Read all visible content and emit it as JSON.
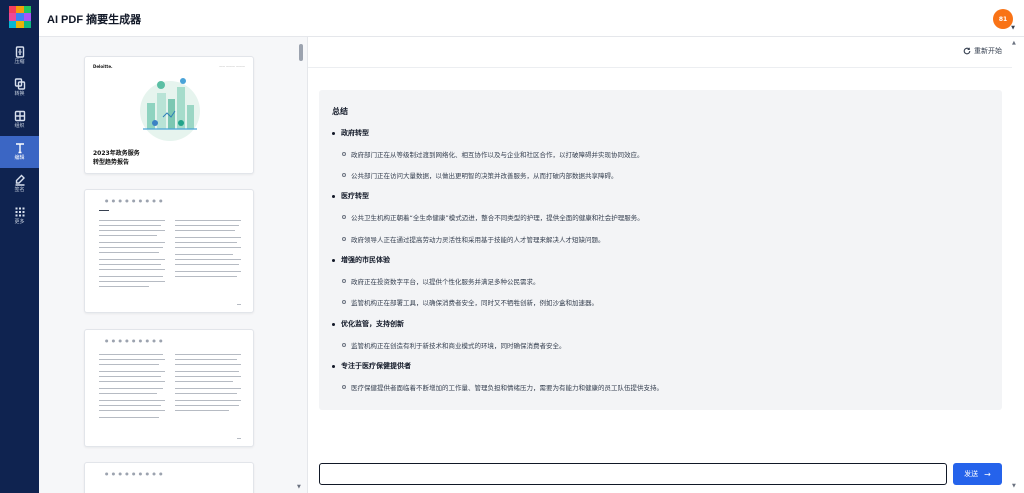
{
  "app": {
    "title": "AI PDF 摘要生成器"
  },
  "sidebar": {
    "items": [
      {
        "label": "压缩",
        "icon": "compress-icon",
        "active": false
      },
      {
        "label": "转换",
        "icon": "convert-icon",
        "active": false
      },
      {
        "label": "组织",
        "icon": "organize-icon",
        "active": false
      },
      {
        "label": "编辑",
        "icon": "text-edit-icon",
        "active": true
      },
      {
        "label": "签名",
        "icon": "sign-icon",
        "active": false
      },
      {
        "label": "更多",
        "icon": "grid-icon",
        "active": false
      }
    ]
  },
  "user": {
    "avatar_initials": "81"
  },
  "document": {
    "cover_title_line1": "2023年政务服务",
    "cover_title_line2": "转型趋势报告",
    "brand": "Deloitte."
  },
  "chat": {
    "restart_label": "重新开始",
    "send_label": "发送",
    "input_value": ""
  },
  "summary": {
    "title": "总结",
    "sections": [
      {
        "heading": "政府转型",
        "items": [
          "政府部门正在从等级制过渡到网络化、相互协作以及与企业和社区合作，以打破障碍并实现协同效应。",
          "公共部门正在访问大量数据，以做出更明智的决策并改善服务，从而打破内部数据共享障碍。"
        ]
      },
      {
        "heading": "医疗转型",
        "items": [
          "公共卫生机构正朝着“全生命健康”模式迈进，整合不同类型的护理，提供全面的健康和社会护理服务。",
          "政府领导人正在通过提高劳动力灵活性和采用基于技能的人才管理来解决人才短缺问题。"
        ]
      },
      {
        "heading": "增强的市民体验",
        "items": [
          "政府正在投资数字平台，以提供个性化服务并满足多种公民需求。",
          "监管机构正在部署工具，以确保消费者安全，同时又不牺牲创新，例如沙盒和加速器。"
        ]
      },
      {
        "heading": "优化监管，支持创新",
        "items": [
          "监管机构正在创造有利于新技术和商业模式的环境，同时确保消费者安全。"
        ]
      },
      {
        "heading": "专注于医疗保健提供者",
        "items": [
          "医疗保健提供者面临着不断增加的工作量、管理负担和情绪压力，需要为有能力和健康的员工队伍提供支持。"
        ]
      }
    ]
  },
  "colors": {
    "sidebar_bg": "#0f2350",
    "sidebar_active": "#3b66c4",
    "accent": "#2563eb",
    "avatar": "#f97316"
  }
}
